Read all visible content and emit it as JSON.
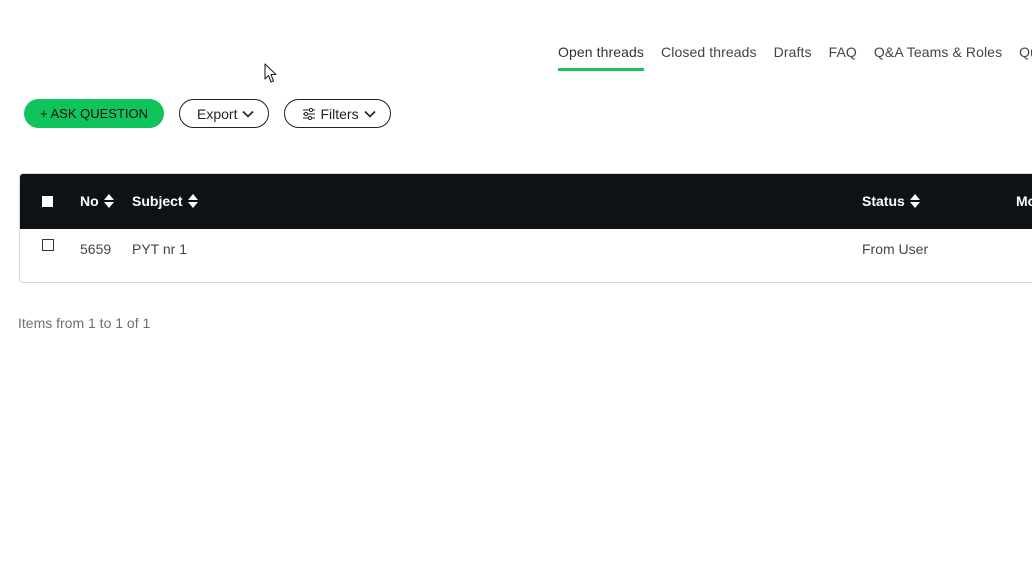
{
  "tabs": [
    {
      "label": "Open threads",
      "active": true
    },
    {
      "label": "Closed threads",
      "active": false
    },
    {
      "label": "Drafts",
      "active": false
    },
    {
      "label": "FAQ",
      "active": false
    },
    {
      "label": "Q&A Teams & Roles",
      "active": false
    },
    {
      "label": "Que",
      "active": false
    }
  ],
  "toolbar": {
    "ask_label": "+ ASK QUESTION",
    "export_label": "Export",
    "filters_label": "Filters"
  },
  "table": {
    "columns": {
      "no": "No",
      "subject": "Subject",
      "status": "Status",
      "more": "Mo"
    },
    "rows": [
      {
        "no": "5659",
        "subject": "PYT nr 1",
        "status": "From User"
      }
    ]
  },
  "pager": {
    "text": "Items from 1 to 1 of 1"
  },
  "colors": {
    "accent": "#10c45c",
    "header_bg": "#0d1217"
  }
}
